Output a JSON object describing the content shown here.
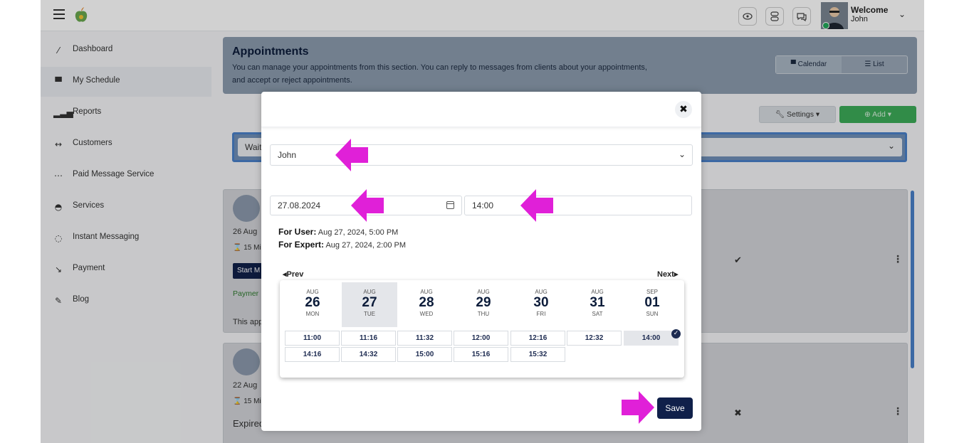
{
  "topbar": {
    "welcome_line1": "Welcome",
    "welcome_line2": "John"
  },
  "sidebar": {
    "items": [
      {
        "label": "Dashboard",
        "icon": "dashboard-icon"
      },
      {
        "label": "My Schedule",
        "icon": "calendar-icon"
      },
      {
        "label": "Reports",
        "icon": "bar-chart-icon"
      },
      {
        "label": "Customers",
        "icon": "customers-icon"
      },
      {
        "label": "Paid Message Service",
        "icon": "message-dots-icon"
      },
      {
        "label": "Services",
        "icon": "services-icon"
      },
      {
        "label": "Instant Messaging",
        "icon": "chat-icon"
      },
      {
        "label": "Payment",
        "icon": "payment-icon"
      },
      {
        "label": "Blog",
        "icon": "pen-icon"
      }
    ]
  },
  "header": {
    "title": "Appointments",
    "description": "You can manage your appointments from this section. You can reply to messages from clients about your appointments, and accept or reject appointments.",
    "view_calendar": "Calendar",
    "view_list": "List"
  },
  "toolbar": {
    "settings_label": "Settings",
    "add_label": "Add"
  },
  "filter": {
    "value": "Wait"
  },
  "cards": [
    {
      "date": "26 Aug",
      "duration": "15 Mi",
      "start_label": "Start M",
      "payment": "Paymer",
      "text": "This app"
    },
    {
      "date": "22 Aug",
      "duration": "15 Mi",
      "status": "Expired"
    }
  ],
  "modal": {
    "user_select": "John",
    "date_value": "27.08.2024",
    "time_value": "14:00",
    "for_user_label": "For User:",
    "for_user_value": "Aug 27, 2024, 5:00 PM",
    "for_expert_label": "For Expert:",
    "for_expert_value": "Aug 27, 2024, 2:00 PM",
    "prev_label": "Prev",
    "next_label": "Next",
    "days": [
      {
        "month": "AUG",
        "day": "26",
        "weekday": "MON"
      },
      {
        "month": "AUG",
        "day": "27",
        "weekday": "TUE"
      },
      {
        "month": "AUG",
        "day": "28",
        "weekday": "WED"
      },
      {
        "month": "AUG",
        "day": "29",
        "weekday": "THU"
      },
      {
        "month": "AUG",
        "day": "30",
        "weekday": "FRI"
      },
      {
        "month": "AUG",
        "day": "31",
        "weekday": "SAT"
      },
      {
        "month": "SEP",
        "day": "01",
        "weekday": "SUN"
      }
    ],
    "slots_row1": [
      "11:00",
      "11:16",
      "11:32",
      "12:00",
      "12:16",
      "12:32",
      "14:00"
    ],
    "slots_row2": [
      "14:16",
      "14:32",
      "15:00",
      "15:16",
      "15:32"
    ],
    "selected_day": "27",
    "selected_slot": "14:00",
    "save_label": "Save"
  },
  "colors": {
    "accent_navy": "#10204a",
    "add_green": "#3cab58",
    "annotation_arrow": "#e020d8"
  }
}
